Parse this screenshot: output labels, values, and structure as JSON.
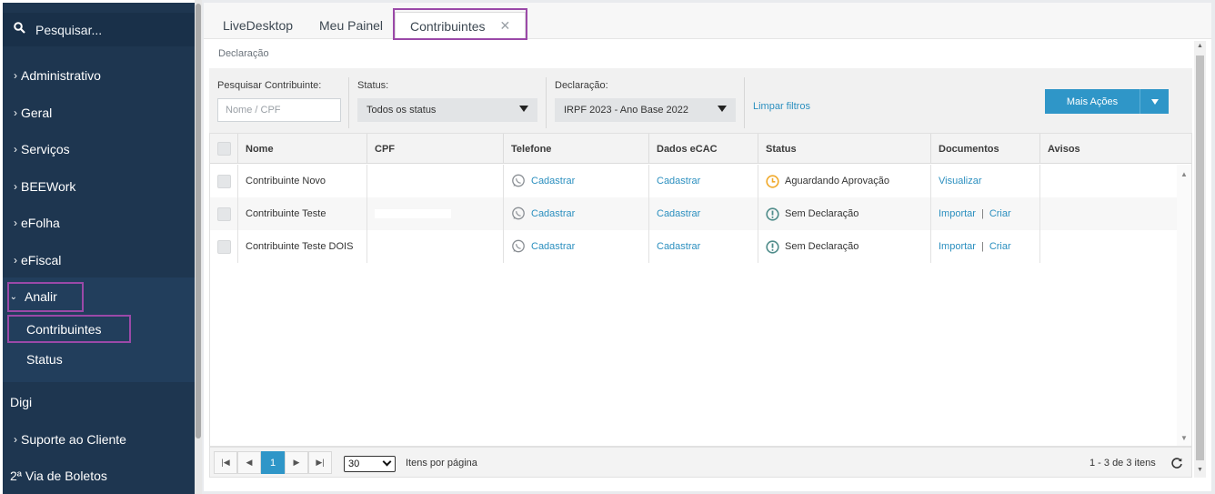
{
  "sidebar": {
    "search_placeholder": "Pesquisar...",
    "items": [
      {
        "label": "Administrativo"
      },
      {
        "label": "Geral"
      },
      {
        "label": "Serviços"
      },
      {
        "label": "BEEWork"
      },
      {
        "label": "eFolha"
      },
      {
        "label": "eFiscal"
      },
      {
        "label": "Analir"
      },
      {
        "label": "Contribuintes"
      },
      {
        "label": "Status"
      },
      {
        "label": "Digi"
      },
      {
        "label": "Suporte ao Cliente"
      },
      {
        "label": "2ª Via de Boletos"
      }
    ]
  },
  "tabs": [
    {
      "label": "LiveDesktop"
    },
    {
      "label": "Meu Painel"
    },
    {
      "label": "Contribuintes"
    }
  ],
  "breadcrumb": "Declaração",
  "filters": {
    "search_label": "Pesquisar Contribuinte:",
    "search_placeholder": "Nome / CPF",
    "status_label": "Status:",
    "status_value": "Todos os status",
    "declaracao_label": "Declaração:",
    "declaracao_value": "IRPF 2023 - Ano Base 2022",
    "clear_label": "Limpar filtros",
    "actions_label": "Mais Ações"
  },
  "table": {
    "columns": [
      "Nome",
      "CPF",
      "Telefone",
      "Dados eCAC",
      "Status",
      "Documentos",
      "Avisos"
    ],
    "rows": [
      {
        "nome": "Contribuinte Novo",
        "telefone": "Cadastrar",
        "ecac": "Cadastrar",
        "status": "Aguardando Aprovação",
        "doc1": "Visualizar",
        "doc2": ""
      },
      {
        "nome": "Contribuinte Teste",
        "telefone": "Cadastrar",
        "ecac": "Cadastrar",
        "status": "Sem Declaração",
        "doc1": "Importar",
        "doc2": "Criar"
      },
      {
        "nome": "Contribuinte Teste DOIS",
        "telefone": "Cadastrar",
        "ecac": "Cadastrar",
        "status": "Sem Declaração",
        "doc1": "Importar",
        "doc2": "Criar"
      }
    ]
  },
  "pager": {
    "current_page": "1",
    "per_page": "30",
    "per_page_label": "Itens por página",
    "count": "1 - 3 de 3 itens"
  },
  "colors": {
    "sidebar_bg": "#1e3650",
    "accent": "#2f96c8",
    "highlight": "#9b49a8",
    "pending": "#f0a92a",
    "neutral_status": "#4f8c8a"
  }
}
